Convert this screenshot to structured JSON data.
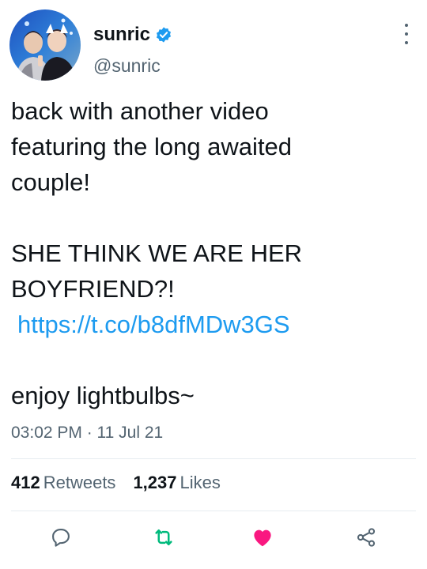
{
  "user": {
    "display_name": "sunric",
    "handle": "@sunric"
  },
  "tweet": {
    "line1": "back with another video",
    "line2": "featuring the long awaited",
    "line3": "couple!",
    "line4": "SHE THINK WE ARE HER",
    "line5": "BOYFRIEND?!",
    "link": "https://t.co/b8dfMDw3GS",
    "line6": "enjoy lightbulbs~"
  },
  "timestamp": "03:02 PM · 11 Jul 21",
  "stats": {
    "retweets_count": "412",
    "retweets_label": "Retweets",
    "likes_count": "1,237",
    "likes_label": "Likes"
  },
  "icons": {
    "verified": "verified-badge-icon",
    "more": "more-vertical-icon",
    "reply": "reply-icon",
    "retweet": "retweet-icon",
    "like": "heart-icon",
    "share": "share-icon"
  },
  "colors": {
    "link": "#1d9bf0",
    "verified": "#1d9bf0",
    "retweet": "#00ba7c",
    "like": "#f91880",
    "secondary": "#536471"
  }
}
